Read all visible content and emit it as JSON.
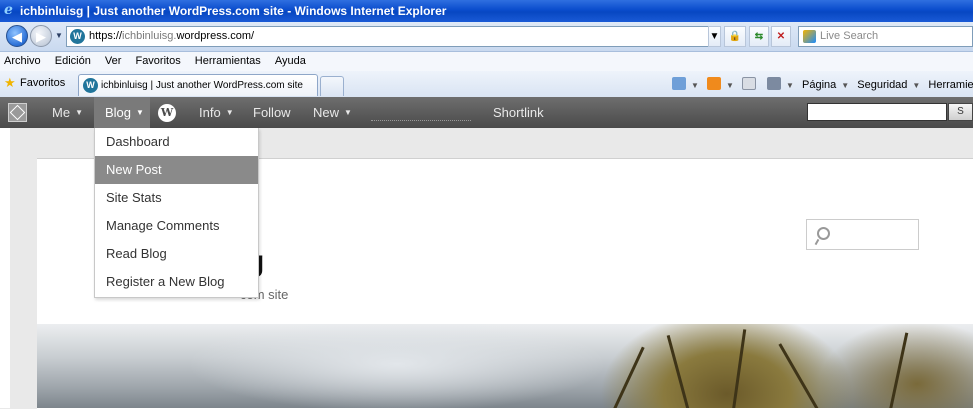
{
  "window": {
    "title": "ichbinluisg | Just another WordPress.com site - Windows Internet Explorer"
  },
  "address": {
    "url_prefix": "https://",
    "url_sub": "ichbinluisg.",
    "url_domain": "wordpress.com/",
    "live_search_placeholder": "Live Search"
  },
  "menu": [
    "Archivo",
    "Edición",
    "Ver",
    "Favoritos",
    "Herramientas",
    "Ayuda"
  ],
  "favbar": {
    "favorites_label": "Favoritos",
    "tab_title": "ichbinluisg | Just another WordPress.com site",
    "page_label": "Página",
    "security_label": "Seguridad",
    "tools_label": "Herramientas"
  },
  "adminbar": {
    "me": "Me",
    "blog": "Blog",
    "info": "Info",
    "follow": "Follow",
    "new": "New",
    "shortlink": "Shortlink",
    "search_button": "S"
  },
  "blog_menu": [
    "Dashboard",
    "New Post",
    "Site Stats",
    "Manage Comments",
    "Read Blog",
    "Register a New Blog"
  ],
  "blog_menu_highlighted": "New Post",
  "site": {
    "title_fragment": "g",
    "description_fragment": "com site"
  }
}
